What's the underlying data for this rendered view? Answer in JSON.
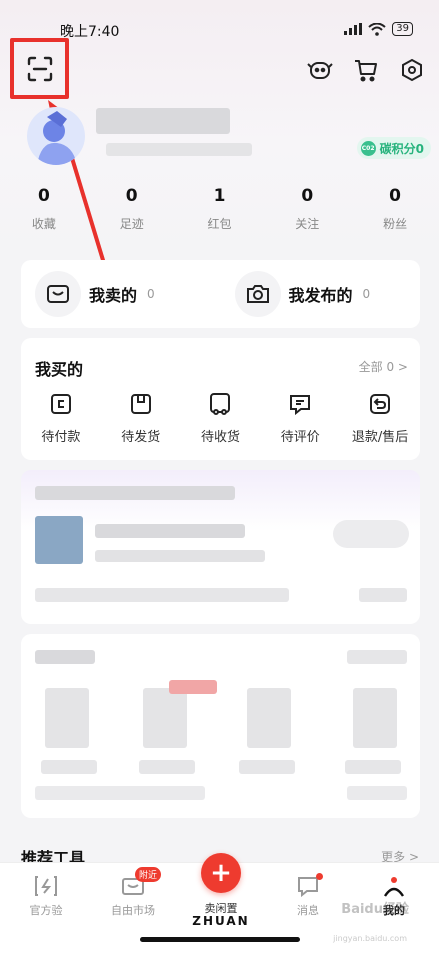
{
  "status_bar": {
    "time": "晚上7:40",
    "battery": "39"
  },
  "header": {
    "icons": [
      "scan-icon",
      "robot-icon",
      "cart-icon",
      "settings-icon"
    ]
  },
  "profile": {
    "carbon_label": "碳积分0",
    "carbon_icon_text": "C02"
  },
  "stats": [
    {
      "value": "0",
      "label": "收藏"
    },
    {
      "value": "0",
      "label": "足迹"
    },
    {
      "value": "1",
      "label": "红包"
    },
    {
      "value": "0",
      "label": "关注"
    },
    {
      "value": "0",
      "label": "粉丝"
    }
  ],
  "sell": [
    {
      "label": "我卖的",
      "count": "0"
    },
    {
      "label": "我发布的",
      "count": "0"
    }
  ],
  "bought": {
    "title": "我买的",
    "all_label": "全部 0 >",
    "items": [
      {
        "label": "待付款"
      },
      {
        "label": "待发货"
      },
      {
        "label": "待收货"
      },
      {
        "label": "待评价"
      },
      {
        "label": "退款/售后"
      }
    ]
  },
  "tools": {
    "title": "推荐工具",
    "more": "更多 >"
  },
  "bottom_nav": {
    "items": [
      {
        "label": "官方验"
      },
      {
        "label": "自由市场",
        "badge": "附近"
      },
      {
        "label": "卖闲置"
      },
      {
        "label": "消息"
      },
      {
        "label": "我的"
      }
    ],
    "brand": "ZHUAN",
    "fab": "+"
  },
  "watermark": {
    "text": "Baidu经验",
    "sub": "jingyan.baidu.com"
  },
  "colors": {
    "accent": "#ee3b2f",
    "highlight_box": "#e8312c",
    "carbon_green": "#27b37d"
  }
}
